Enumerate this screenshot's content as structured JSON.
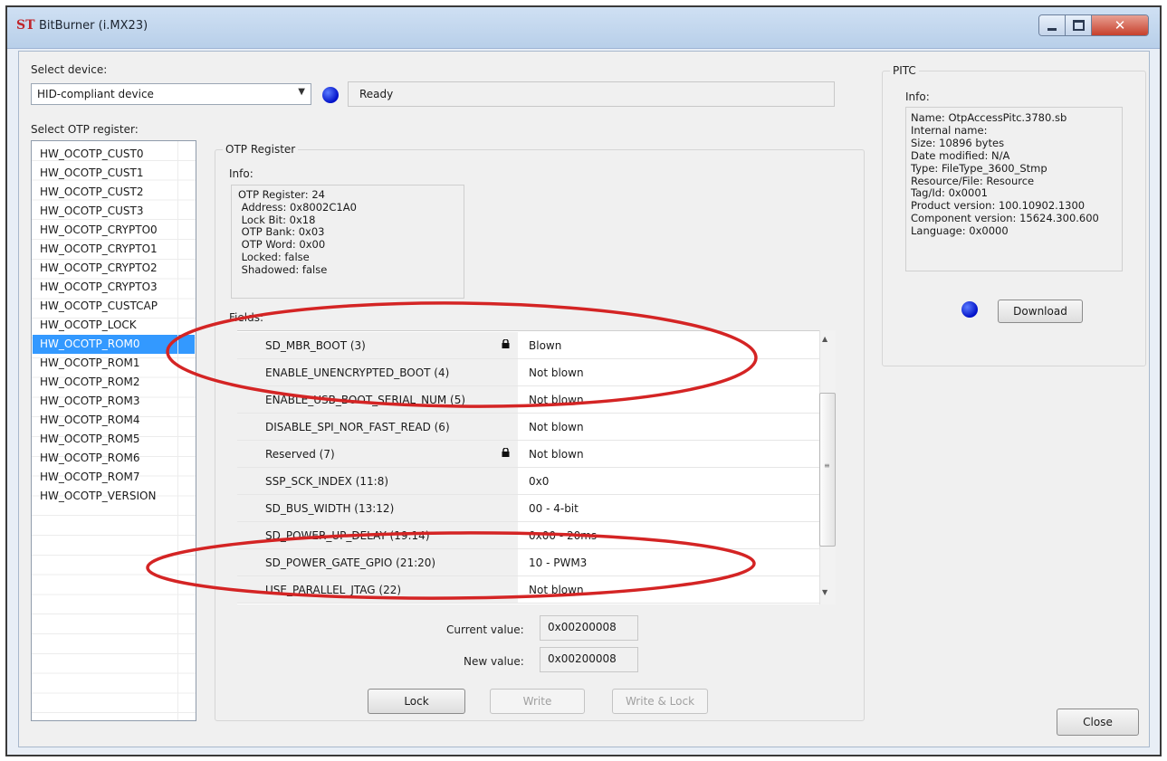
{
  "window": {
    "logo": "ST",
    "title": "BitBurner (i.MX23)"
  },
  "device": {
    "label": "Select device:",
    "value": "HID-compliant device",
    "status": "Ready"
  },
  "registers": {
    "label": "Select OTP register:",
    "items": [
      "HW_OCOTP_CUST0",
      "HW_OCOTP_CUST1",
      "HW_OCOTP_CUST2",
      "HW_OCOTP_CUST3",
      "HW_OCOTP_CRYPTO0",
      "HW_OCOTP_CRYPTO1",
      "HW_OCOTP_CRYPTO2",
      "HW_OCOTP_CRYPTO3",
      "HW_OCOTP_CUSTCAP",
      "HW_OCOTP_LOCK",
      "HW_OCOTP_ROM0",
      "HW_OCOTP_ROM1",
      "HW_OCOTP_ROM2",
      "HW_OCOTP_ROM3",
      "HW_OCOTP_ROM4",
      "HW_OCOTP_ROM5",
      "HW_OCOTP_ROM6",
      "HW_OCOTP_ROM7",
      "HW_OCOTP_VERSION"
    ],
    "selected": "HW_OCOTP_ROM0"
  },
  "otp": {
    "group_title": "OTP Register",
    "info_label": "Info:",
    "info_lines": "OTP Register: 24\n Address: 0x8002C1A0\n Lock Bit: 0x18\n OTP Bank: 0x03\n OTP Word: 0x00\n Locked: false\n Shadowed: false",
    "fields_label": "Fields:",
    "fields": [
      {
        "name": "SD_MBR_BOOT (3)",
        "value": "Blown",
        "locked": true
      },
      {
        "name": "ENABLE_UNENCRYPTED_BOOT (4)",
        "value": "Not blown",
        "locked": false
      },
      {
        "name": "ENABLE_USB_BOOT_SERIAL_NUM (5)",
        "value": "Not blown",
        "locked": false
      },
      {
        "name": "DISABLE_SPI_NOR_FAST_READ (6)",
        "value": "Not blown",
        "locked": false
      },
      {
        "name": "Reserved (7)",
        "value": "Not blown",
        "locked": true
      },
      {
        "name": "SSP_SCK_INDEX (11:8)",
        "value": "0x0",
        "locked": false
      },
      {
        "name": "SD_BUS_WIDTH (13:12)",
        "value": "00 - 4-bit",
        "locked": false
      },
      {
        "name": "SD_POWER_UP_DELAY (19:14)",
        "value": "0x00 - 20ms",
        "locked": false
      },
      {
        "name": "SD_POWER_GATE_GPIO (21:20)",
        "value": "10 - PWM3",
        "locked": false
      },
      {
        "name": "USE_PARALLEL_JTAG (22)",
        "value": "Not blown",
        "locked": false
      }
    ],
    "current_label": "Current value:",
    "current_value": "0x00200008",
    "new_label": "New value:",
    "new_value": "0x00200008",
    "lock_btn": "Lock",
    "write_btn": "Write",
    "write_lock_btn": "Write & Lock"
  },
  "pitc": {
    "group_title": "PITC",
    "info_label": "Info:",
    "info_lines": "Name: OtpAccessPitc.3780.sb\nInternal name:\nSize: 10896 bytes\nDate modified: N/A\nType: FileType_3600_Stmp\nResource/File: Resource\nTag/Id: 0x0001\nProduct version: 100.10902.1300\nComponent version: 15624.300.600\nLanguage: 0x0000",
    "download_btn": "Download"
  },
  "close_btn": "Close",
  "colors": {
    "selection": "#3399ff",
    "status_dot": "#0010c8",
    "annotation": "#d42424"
  },
  "icons": {
    "combo_arrow": "chevron-down-icon",
    "field_lock": "lock-icon"
  }
}
